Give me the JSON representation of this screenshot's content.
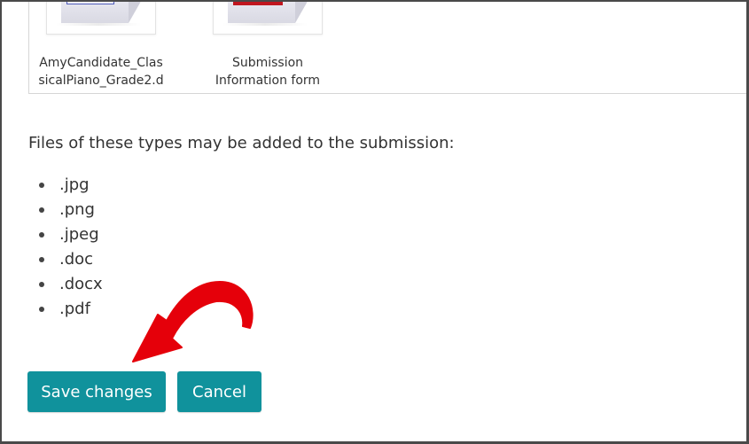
{
  "attachments": [
    {
      "name": "AmyCandidate_ClassicalPiano_Grade2.d",
      "name_lines": [
        "AmyCandidate_Clas",
        "sicalPiano_Grade2.d"
      ],
      "icon": "document-icon",
      "accent_color": "#4b58b8"
    },
    {
      "name": "Submission Information form",
      "name_lines": [
        "Submission",
        "Information form"
      ],
      "icon": "pdf-document-icon",
      "accent_color": "#c0161f"
    }
  ],
  "file_types": {
    "heading": "Files of these types may be added to the submission:",
    "items": [
      ".jpg",
      ".png",
      ".jpeg",
      ".doc",
      ".docx",
      ".pdf"
    ]
  },
  "actions": {
    "save_label": "Save changes",
    "cancel_label": "Cancel",
    "button_color": "#10929c"
  },
  "annotation": {
    "type": "curved-arrow",
    "points_to": "save-changes-button",
    "color": "#e5000a"
  }
}
